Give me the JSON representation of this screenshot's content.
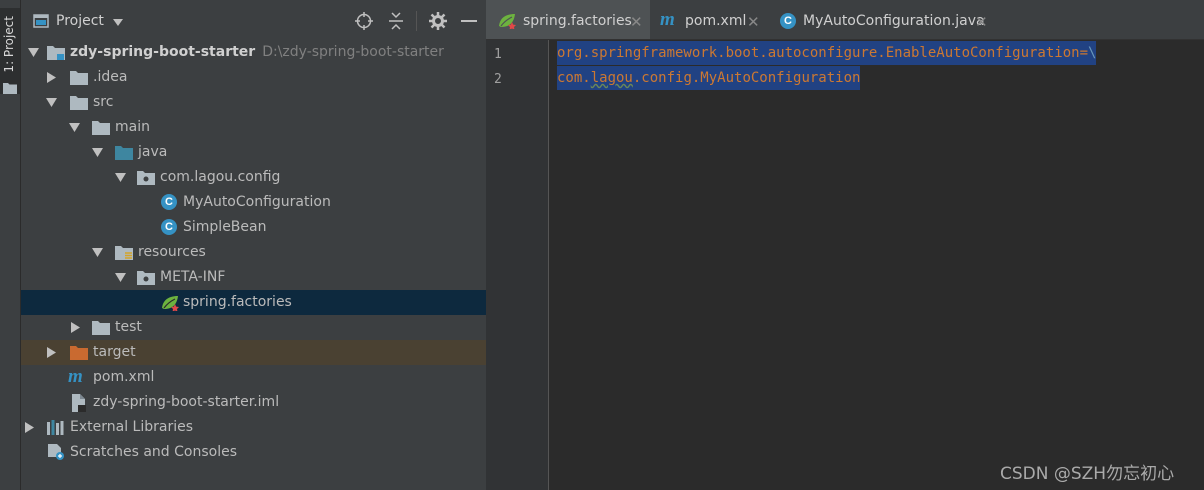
{
  "toolwindow_strip": {
    "project_tab_label": "1: Project"
  },
  "project_panel": {
    "header": {
      "title": "Project",
      "icons": [
        "locate-icon",
        "collapse-icon",
        "gear-icon",
        "hide-icon"
      ]
    },
    "tree": [
      {
        "label": "zdy-spring-boot-starter",
        "hint": "D:\\zdy-spring-boot-starter",
        "icon": "module-folder-icon",
        "expanded": true,
        "depth": 0
      },
      {
        "label": ".idea",
        "icon": "folder-icon",
        "expanded": false,
        "depth": 1
      },
      {
        "label": "src",
        "icon": "folder-icon",
        "expanded": true,
        "depth": 1
      },
      {
        "label": "main",
        "icon": "folder-icon",
        "expanded": true,
        "depth": 2
      },
      {
        "label": "java",
        "icon": "source-folder-icon",
        "expanded": true,
        "depth": 3
      },
      {
        "label": "com.lagou.config",
        "icon": "package-icon",
        "expanded": true,
        "depth": 4
      },
      {
        "label": "MyAutoConfiguration",
        "icon": "class-icon",
        "depth": 5
      },
      {
        "label": "SimpleBean",
        "icon": "class-icon",
        "depth": 5
      },
      {
        "label": "resources",
        "icon": "resources-folder-icon",
        "expanded": true,
        "depth": 3
      },
      {
        "label": "META-INF",
        "icon": "package-icon",
        "expanded": true,
        "depth": 4
      },
      {
        "label": "spring.factories",
        "icon": "spring-icon",
        "depth": 5,
        "selected": true
      },
      {
        "label": "test",
        "icon": "folder-icon",
        "expanded": false,
        "depth": 2
      },
      {
        "label": "target",
        "icon": "excluded-folder-icon",
        "expanded": false,
        "depth": 1
      },
      {
        "label": "pom.xml",
        "icon": "maven-icon",
        "depth": 1
      },
      {
        "label": "zdy-spring-boot-starter.iml",
        "icon": "iml-file-icon",
        "depth": 1
      },
      {
        "label": "External Libraries",
        "icon": "libraries-icon",
        "expanded": false,
        "depth": 0
      },
      {
        "label": "Scratches and Consoles",
        "icon": "scratches-icon",
        "depth": 0
      }
    ]
  },
  "editor": {
    "tabs": [
      {
        "label": "spring.factories",
        "icon": "spring-icon",
        "active": true
      },
      {
        "label": "pom.xml",
        "icon": "maven-icon",
        "active": false
      },
      {
        "label": "MyAutoConfiguration.java",
        "icon": "class-icon",
        "active": false
      }
    ],
    "lines": [
      {
        "number": "1",
        "key": "org.springframework.boot.autoconfigure.EnableAutoConfiguration",
        "sep": "=",
        "cont": "\\"
      },
      {
        "number": "2",
        "pre": "com.",
        "underlined": "lagou",
        "post": ".config.MyAutoConfiguration"
      }
    ]
  },
  "watermark": "CSDN @SZH勿忘初心",
  "colors": {
    "panel_bg": "#3c3f41",
    "editor_bg": "#2b2b2b",
    "selection": "#214283",
    "tree_selected": "#0d293e",
    "excluded_row": "#4a4132",
    "keyword": "#cc7832",
    "class_icon": "#3592c4",
    "folder_icon": "#aeb9c0",
    "source_folder": "#3e86a0",
    "excluded_folder": "#c96a30",
    "spring_green": "#6db33f"
  }
}
